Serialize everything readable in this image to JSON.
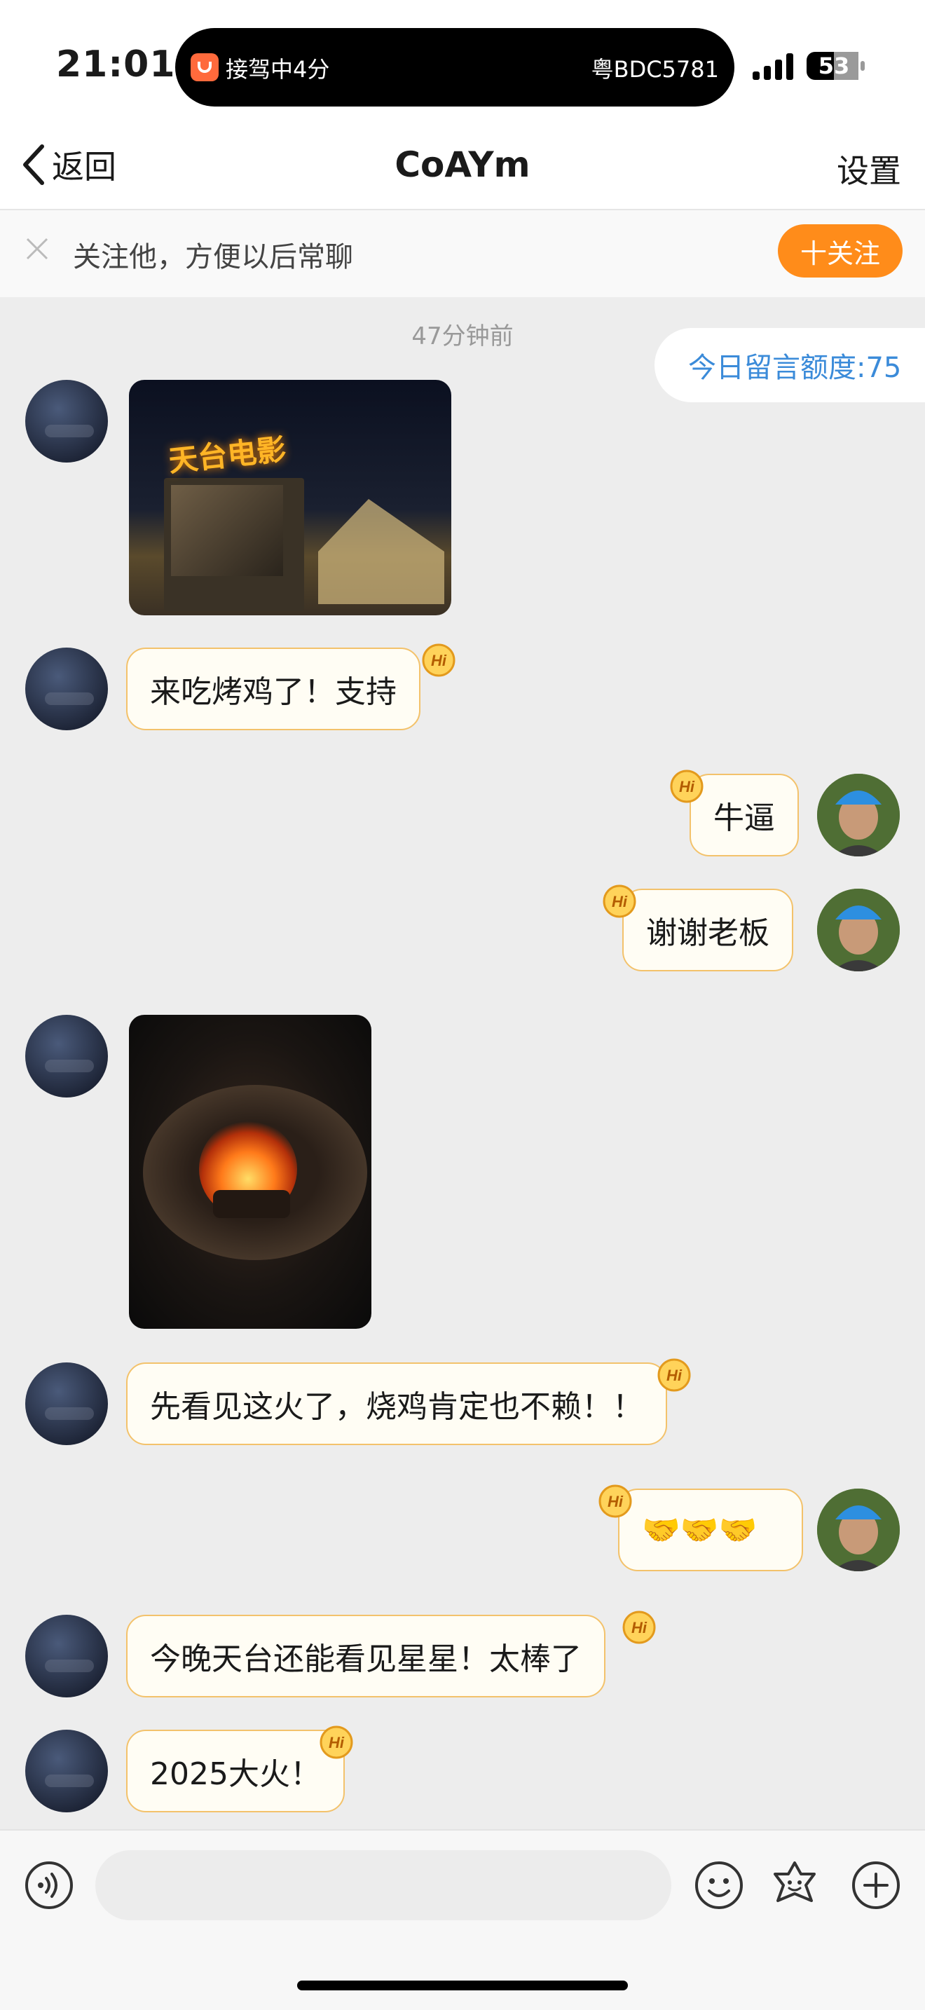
{
  "status_bar": {
    "time": "21:01",
    "live_activity_left": "接驾中4分",
    "live_activity_right": "粤BDC5781",
    "battery": "53"
  },
  "nav": {
    "back_label": "返回",
    "title": "CoAYm",
    "settings_label": "设置"
  },
  "follow_bar": {
    "text": "关注他，方便以后常聊",
    "button_label": "十关注"
  },
  "chat": {
    "timestamp": "47分钟前",
    "quota": "今日留言额度:75",
    "messages": [
      {
        "side": "left",
        "type": "image",
        "sign_text": "天台电影"
      },
      {
        "side": "left",
        "type": "text",
        "text": "来吃烤鸡了！支持"
      },
      {
        "side": "right",
        "type": "text",
        "text": "牛逼"
      },
      {
        "side": "right",
        "type": "text",
        "text": "谢谢老板"
      },
      {
        "side": "left",
        "type": "image",
        "description": "fire"
      },
      {
        "side": "left",
        "type": "text",
        "text": "先看见这火了，烧鸡肯定也不赖！！"
      },
      {
        "side": "right",
        "type": "text",
        "text": "🤝🤝🤝"
      },
      {
        "side": "left",
        "type": "text",
        "text": "今晚天台还能看见星星！太棒了"
      },
      {
        "side": "left",
        "type": "text",
        "text": "2025大火！"
      }
    ],
    "hi_badge": "Hi"
  },
  "input_bar": {
    "placeholder": ""
  },
  "colors": {
    "accent_orange": "#ff8c1a",
    "bubble_border": "#f3c26b",
    "quota_blue": "#3b8bd9"
  }
}
